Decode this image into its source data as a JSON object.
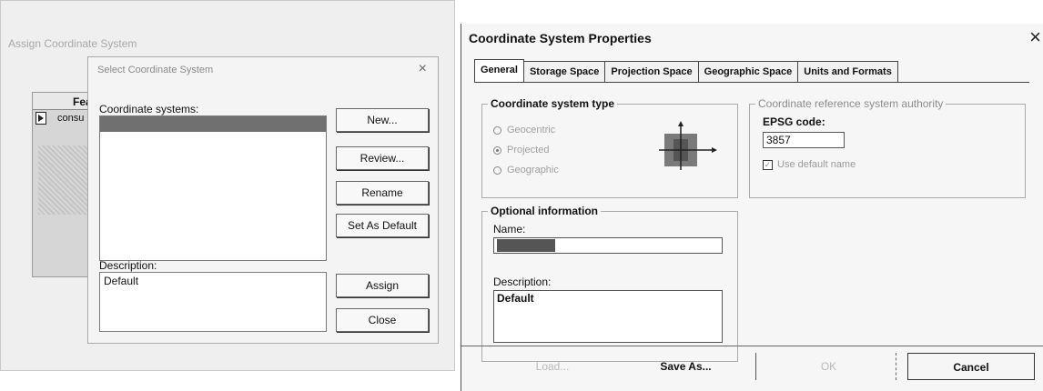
{
  "background_window": {
    "title": "Assign Coordinate System",
    "grid_header": "Feat",
    "grid_row": "consu"
  },
  "select_dialog": {
    "title": "Select Coordinate System",
    "close_glyph": "×",
    "coord_label": "Coordinate systems:",
    "coord_item": "",
    "description_label": "Description:",
    "description_value": "Default",
    "buttons": {
      "new": "New...",
      "review": "Review...",
      "rename": "Rename",
      "set_default": "Set As Default",
      "assign": "Assign",
      "close": "Close"
    }
  },
  "csp": {
    "title": "Coordinate System Properties",
    "close_glyph": "×",
    "tabs": [
      "General",
      "Storage Space",
      "Projection Space",
      "Geographic Space",
      "Units and Formats"
    ],
    "type_group": {
      "title": "Coordinate system type",
      "options": [
        "Geocentric",
        "Projected",
        "Geographic"
      ],
      "selected": 1
    },
    "authority_group": {
      "title": "Coordinate reference system authority",
      "epsg_label": "EPSG code:",
      "epsg_value": "3857",
      "default_checkbox": "Use default name",
      "default_checked": true
    },
    "optional_group": {
      "title": "Optional information",
      "name_label": "Name:",
      "name_value": "",
      "description_label": "Description:",
      "description_value": "Default"
    },
    "buttons": {
      "load": "Load...",
      "save_as": "Save As...",
      "ok": "OK",
      "cancel": "Cancel"
    }
  }
}
